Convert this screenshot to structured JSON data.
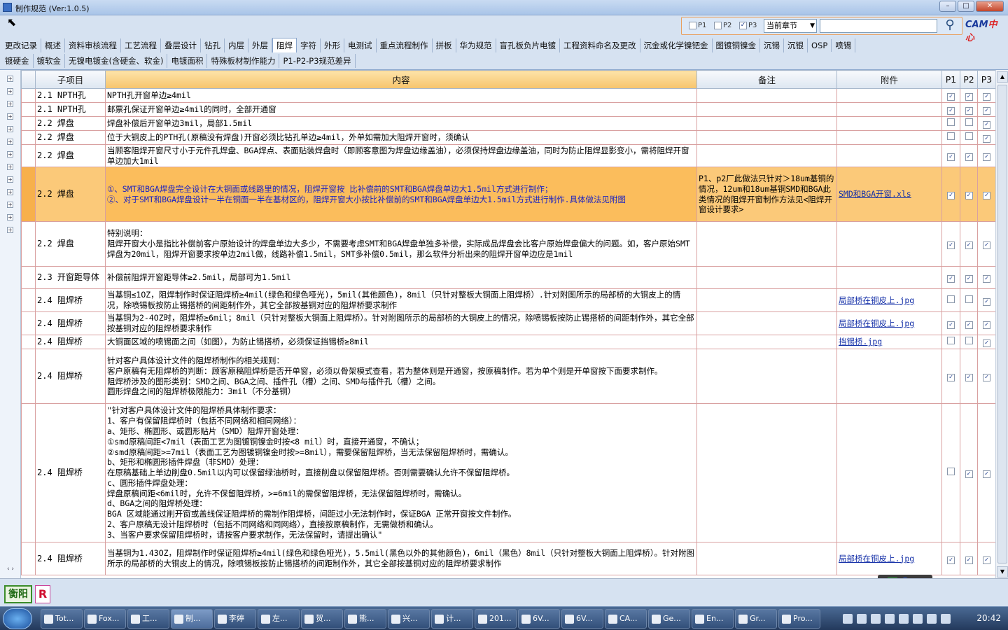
{
  "window": {
    "title": "制作规范 (Ver:1.0.5)"
  },
  "filter": {
    "p1_label": "P1",
    "p2_label": "P2",
    "p3_label": "P3",
    "p1_checked": false,
    "p2_checked": false,
    "p3_checked": true,
    "chapter_select": "当前章节",
    "search_placeholder": ""
  },
  "logo": {
    "text_a": "CAM",
    "text_b": "中心"
  },
  "tabs_row1": [
    "更改记录",
    "概述",
    "资料审核流程",
    "工艺流程",
    "叠层设计",
    "钻孔",
    "内层",
    "外层",
    "阻焊",
    "字符",
    "外形",
    "电测试",
    "重点流程制作",
    "拼板",
    "华为规范",
    "盲孔板负片电镀",
    "工程资料命名及更改",
    "沉金或化学镍钯金",
    "图镀铜镍金",
    "沉锡",
    "沉银",
    "OSP",
    "喷锡"
  ],
  "tabs_row2": [
    "镀硬金",
    "镀软金",
    "无镍电镀金(含硬金、软金)",
    "电镀面积",
    "特殊板材制作能力",
    "P1-P2-P3规范差异"
  ],
  "active_tab": "阻焊",
  "columns": {
    "sub": "子项目",
    "content": "内容",
    "note": "备注",
    "attach": "附件",
    "p1": "P1",
    "p2": "P2",
    "p3": "P3"
  },
  "rows": [
    {
      "sub": "2.1 NPTH孔",
      "content": "NPTH孔开窗单边≥4mil",
      "note": "",
      "attach": "",
      "p1": true,
      "p2": true,
      "p3": true
    },
    {
      "sub": "2.1 NPTH孔",
      "content": "邮票孔保证开窗单边≥4mil的同时，全部开通窗",
      "note": "",
      "attach": "",
      "p1": true,
      "p2": true,
      "p3": true
    },
    {
      "sub": "2.2 焊盘",
      "content": "焊盘补偿后开窗单边3mil，局部1.5mil",
      "note": "",
      "attach": "",
      "p1": false,
      "p2": false,
      "p3": true
    },
    {
      "sub": "2.2 焊盘",
      "content": "位于大铜皮上的PTH孔(原稿没有焊盘)开窗必须比钻孔单边≥4mil，外单如需加大阻焊开窗时，须确认",
      "note": "",
      "attach": "",
      "p1": false,
      "p2": false,
      "p3": true
    },
    {
      "sub": "2.2 焊盘",
      "content": "当顾客阻焊开窗尺寸小于元件孔焊盘、BGA焊点、表面贴装焊盘时（即顾客意图为焊盘边缘盖油），必须保持焊盘边缘盖油，同时为防止阻焊显影变小，需将阻焊开窗单边加大1mil",
      "note": "",
      "attach": "",
      "p1": true,
      "p2": true,
      "p3": true
    },
    {
      "sub": "2.2 焊盘",
      "content": "①、SMT和BGA焊盘完全设计在大铜面或线路里的情况，阻焊开窗按 比补偿前的SMT和BGA焊盘单边大1.5mil方式进行制作；\n②、对于SMT和BGA焊盘设计一半在铜面一半在基材区的，阻焊开窗大小按比补偿前的SMT和BGA焊盘单边大1.5mil方式进行制作.具体做法见附图",
      "note": "P1、p2厂此做法只针对＞18um基铜的情况，12um和18um基铜SMD和BGA此类情况的阻焊开窗制作方法见<阻焊开窗设计要求>",
      "attach": "SMD和BGA开窗.xls",
      "p1": true,
      "p2": true,
      "p3": true,
      "highlight": true
    },
    {
      "sub": "2.2 焊盘",
      "content": "特别说明：\n阻焊开窗大小是指比补偿前客户原始设计的焊盘单边大多少，不需要考虑SMT和BGA焊盘单独多补偿，实际成品焊盘会比客户原始焊盘偏大的问题。如，客户原始SMT焊盘为20mil，阻焊开窗要求按单边2mil做，线路补偿1.5mil，SMT多补偿0.5mil，那么软件分析出来的阻焊开窗单边应是1mil",
      "note": "",
      "attach": "",
      "p1": true,
      "p2": true,
      "p3": true
    },
    {
      "sub": "2.3 开窗距导体",
      "content": "补偿前阻焊开窗距导体≥2.5mil，局部可为1.5mil",
      "note": "",
      "attach": "",
      "p1": true,
      "p2": true,
      "p3": true
    },
    {
      "sub": "2.4 阻焊桥",
      "content": "当基铜≤1OZ，阻焊制作时保证阻焊桥≥4mil(绿色和绿色哑光)，5mil(其他颜色)，8mil（只针对整板大铜面上阻焊桥）.针对附图所示的局部桥的大铜皮上的情况，除喷锡板按防止锡搭桥的间距制作外，其它全部按基铜对应的阻焊桥要求制作",
      "note": "",
      "attach": "局部桥在铜皮上.jpg",
      "p1": false,
      "p2": false,
      "p3": true
    },
    {
      "sub": "2.4 阻焊桥",
      "content": "当基铜为2-4OZ时，阻焊桥≥6mil；8mil（只针对整板大铜面上阻焊桥）。针对附图所示的局部桥的大铜皮上的情况，除喷锡板按防止锡搭桥的间距制作外，其它全部按基铜对应的阻焊桥要求制作",
      "note": "",
      "attach": "局部桥在铜皮上.jpg",
      "p1": true,
      "p2": true,
      "p3": true
    },
    {
      "sub": "2.4 阻焊桥",
      "content": "大铜面区域的喷锡面之间（如图），为防止锡搭桥，必须保证挡锡桥≥8mil",
      "note": "",
      "attach": "挡锡桥.jpg",
      "p1": false,
      "p2": false,
      "p3": true
    },
    {
      "sub": "2.4 阻焊桥",
      "content": "针对客户具体设计文件的阻焊桥制作的相关规则：\n客户原稿有无阻焊桥的判断：顾客原稿阻焊桥是否开单窗，必须以骨架模式查看，若为整体则是开通窗，按原稿制作。若为单个则是开单窗按下面要求制作。\n阻焊桥涉及的图形类别：SMD之间、BGA之间、插件孔（槽）之间、SMD与插件孔（槽）之间。\n圆形焊盘之间的阻焊桥极限能力：3mil（不分基铜）",
      "note": "",
      "attach": "",
      "p1": true,
      "p2": true,
      "p3": true
    },
    {
      "sub": "2.4 阻焊桥",
      "content": "\"针对客户具体设计文件的阻焊桥具体制作要求：\n1、客户有保留阻焊桥时（包括不同网络和相同网络）：\na、矩形、椭圆形、或圆形贴片（SMD）阻焊开窗处理：\n①smd原稿间距<7mil（表面工艺为图镀铜镍金时按<8 mil）时，直接开通窗，不确认；\n②smd原稿间距>=7mil（表面工艺为图镀铜镍金时按>=8mil），需要保留阻焊桥，当无法保留阻焊桥时，需确认。\nb、矩形和椭圆形插件焊盘（非SMD）处理：\n在原稿基础上单边削盘0.5mil以内可以保留绿油桥时，直接削盘以保留阻焊桥。否则需要确认允许不保留阻焊桥。\nc、圆形插件焊盘处理：\n焊盘原稿间距<6mil时，允许不保留阻焊桥，>=6mil的需保留阻焊桥，无法保留阻焊桥时，需确认。\nd、BGA之间的阻焊桥处理：\nBGA 区域能通过削开窗或盖线保证阻焊桥的需制作阻焊桥，间距过小无法制作时，保证BGA 正常开窗按文件制作。\n2、客户原稿无设计阻焊桥时（包括不同网络和同网络），直接按原稿制作，无需做桥和确认。\n3、当客户要求保留阻焊桥时，请按客户要求制作，无法保留时，请提出确认\"",
      "note": "",
      "attach": "",
      "p1": false,
      "p2": true,
      "p3": true
    },
    {
      "sub": "2.4 阻焊桥",
      "content": "当基铜为1.43OZ，阻焊制作时保证阻焊桥≥4mil(绿色和绿色哑光)，5.5mil(黑色以外的其他颜色)，6mil（黑色）8mil（只针对整板大铜面上阻焊桥）。针对附图所示的局部桥的大铜皮上的情况，除喷锡板按防止锡搭桥的间距制作外，其它全部按基铜对应的阻焊桥要求制作",
      "note": "",
      "attach": "局部桥在铜皮上.jpg",
      "p1": true,
      "p2": true,
      "p3": true
    }
  ],
  "status": {
    "site_label": "衡阳",
    "r_label": "R"
  },
  "taskbar": {
    "items": [
      "Tot...",
      "Fox...",
      "工...",
      "制...",
      "李婷",
      "左...",
      "贺...",
      "熊...",
      "兴...",
      "计...",
      "201...",
      "6V...",
      "6V...",
      "CA...",
      "Ge...",
      "En...",
      "Gr...",
      "Pro..."
    ],
    "clock": "20:42"
  }
}
